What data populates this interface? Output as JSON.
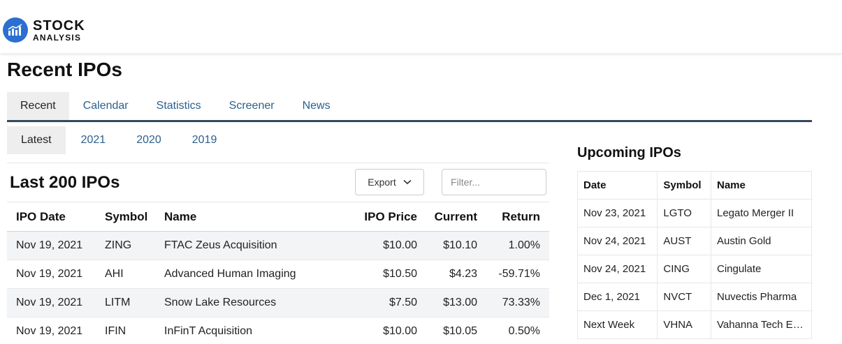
{
  "brand": {
    "line1": "STOCK",
    "line2": "ANALYSIS",
    "color": "#2c6fd1"
  },
  "page_title": "Recent IPOs",
  "tabs": [
    {
      "label": "Recent",
      "active": true
    },
    {
      "label": "Calendar"
    },
    {
      "label": "Statistics"
    },
    {
      "label": "Screener"
    },
    {
      "label": "News"
    }
  ],
  "subtabs": [
    {
      "label": "Latest",
      "active": true
    },
    {
      "label": "2021"
    },
    {
      "label": "2020"
    },
    {
      "label": "2019"
    }
  ],
  "ipo_section": {
    "title": "Last 200 IPOs",
    "export_label": "Export",
    "filter_placeholder": "Filter...",
    "columns": [
      "IPO Date",
      "Symbol",
      "Name",
      "IPO Price",
      "Current",
      "Return"
    ],
    "rows": [
      {
        "date": "Nov 19, 2021",
        "symbol": "ZING",
        "name": "FTAC Zeus Acquisition",
        "ipo_price": "$10.00",
        "current": "$10.10",
        "return": "1.00%",
        "trend": "pos"
      },
      {
        "date": "Nov 19, 2021",
        "symbol": "AHI",
        "name": "Advanced Human Imaging",
        "ipo_price": "$10.50",
        "current": "$4.23",
        "return": "-59.71%",
        "trend": "neg"
      },
      {
        "date": "Nov 19, 2021",
        "symbol": "LITM",
        "name": "Snow Lake Resources",
        "ipo_price": "$7.50",
        "current": "$13.00",
        "return": "73.33%",
        "trend": "pos"
      },
      {
        "date": "Nov 19, 2021",
        "symbol": "IFIN",
        "name": "InFinT Acquisition",
        "ipo_price": "$10.00",
        "current": "$10.05",
        "return": "0.50%",
        "trend": "pos"
      }
    ]
  },
  "upcoming": {
    "title": "Upcoming IPOs",
    "columns": [
      "Date",
      "Symbol",
      "Name"
    ],
    "rows": [
      {
        "date": "Nov 23, 2021",
        "symbol": "LGTO",
        "name": "Legato Merger II"
      },
      {
        "date": "Nov 24, 2021",
        "symbol": "AUST",
        "name": "Austin Gold"
      },
      {
        "date": "Nov 24, 2021",
        "symbol": "CING",
        "name": "Cingulate"
      },
      {
        "date": "Dec 1, 2021",
        "symbol": "NVCT",
        "name": "Nuvectis Pharma"
      },
      {
        "date": "Next Week",
        "symbol": "VHNA",
        "name": "Vahanna Tech Ed..."
      }
    ]
  },
  "colors": {
    "positive": "#1b8a3a",
    "negative": "#dc2626",
    "link": "#2c6fb6",
    "tab_border": "#34495e"
  }
}
